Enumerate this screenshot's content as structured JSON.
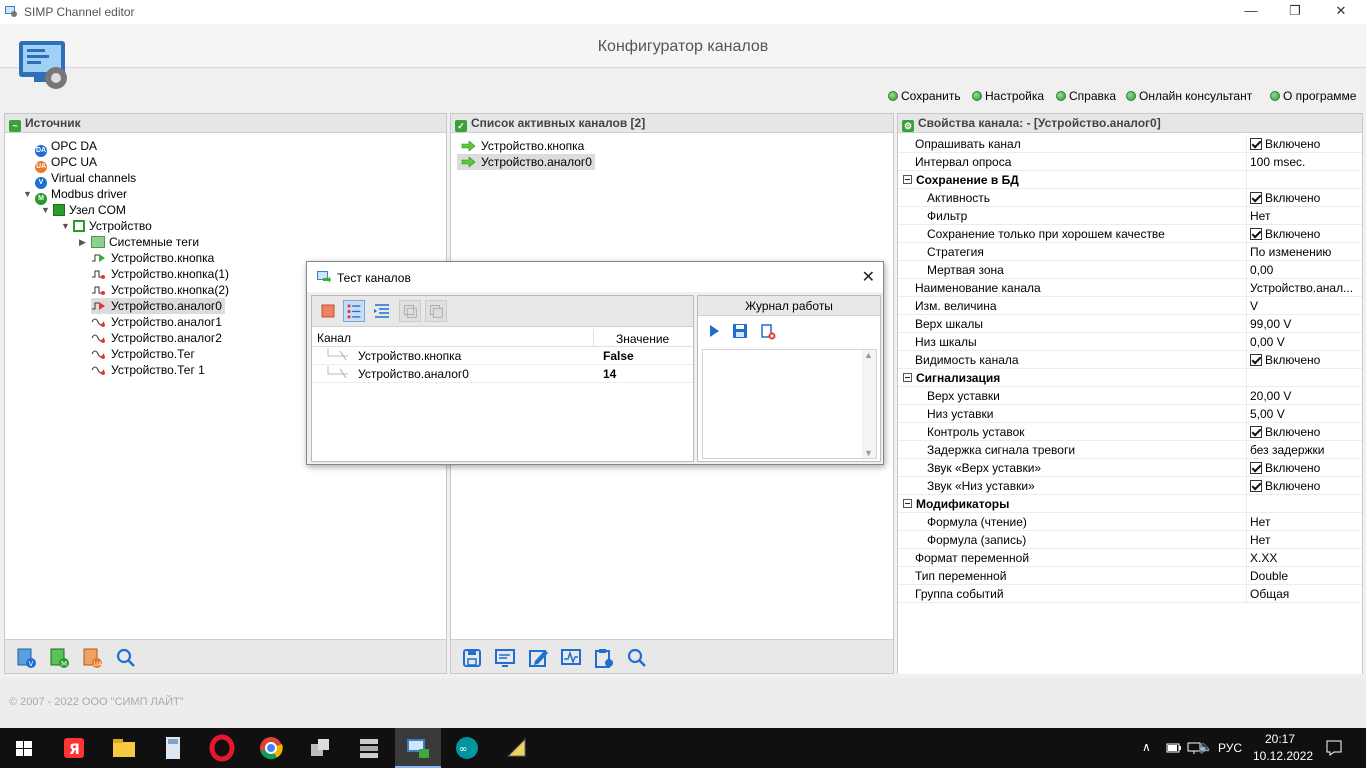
{
  "window": {
    "title": "SIMP Channel editor",
    "minimize": "—",
    "restore": "❐",
    "close": "✕"
  },
  "header": {
    "title": "Конфигуратор каналов"
  },
  "menu": [
    {
      "label": "Сохранить"
    },
    {
      "label": "Настройка"
    },
    {
      "label": "Справка"
    },
    {
      "label": "Онлайн консультант"
    },
    {
      "label": "О программе"
    }
  ],
  "source_panel": {
    "title": "Источник",
    "tree": [
      {
        "label": "OPC DA",
        "icon": "opc-da-icon"
      },
      {
        "label": "OPC UA",
        "icon": "opc-ua-icon"
      },
      {
        "label": "Virtual channels",
        "icon": "virtual-channels-icon"
      },
      {
        "label": "Modbus driver",
        "icon": "modbus-driver-icon"
      },
      {
        "label": "Узел COM",
        "icon": "com-node-icon"
      },
      {
        "label": "Устройство",
        "icon": "device-icon"
      },
      {
        "label": "Системные теги",
        "icon": "folder-icon"
      },
      {
        "label": "Устройство.кнопка",
        "icon": "channel-active-icon"
      },
      {
        "label": "Устройство.кнопка(1)",
        "icon": "channel-icon"
      },
      {
        "label": "Устройство.кнопка(2)",
        "icon": "channel-icon"
      },
      {
        "label": "Устройство.аналог0",
        "icon": "channel-active-icon"
      },
      {
        "label": "Устройство.аналог1",
        "icon": "channel-icon"
      },
      {
        "label": "Устройство.аналог2",
        "icon": "channel-icon"
      },
      {
        "label": "Устройство.Тег",
        "icon": "channel-icon"
      },
      {
        "label": "Устройство.Тег 1",
        "icon": "channel-icon"
      }
    ],
    "toolbar": [
      "add-virtual-icon",
      "add-modbus-icon",
      "add-opc-ua-icon",
      "search-icon"
    ]
  },
  "active_panel": {
    "title": "Список активных каналов [2]",
    "items": [
      {
        "label": "Устройство.кнопка"
      },
      {
        "label": "Устройство.аналог0"
      }
    ],
    "toolbar": [
      "save-icon",
      "monitor-icon",
      "edit-icon",
      "chart-icon",
      "settings-icon",
      "search-icon"
    ]
  },
  "props_panel": {
    "title": "Свойства канала: - [Устройство.аналог0]",
    "rows": [
      {
        "name": "Опрашивать канал",
        "value": "Включено",
        "check": true
      },
      {
        "name": "Интервал опроса",
        "value": "100 msec."
      },
      {
        "name": "Сохранение в БД",
        "value": "",
        "cat": true
      },
      {
        "name": "Активность",
        "value": "Включено",
        "check": true,
        "indent": true
      },
      {
        "name": "Фильтр",
        "value": "Нет",
        "indent": true
      },
      {
        "name": "Сохранение только при хорошем качестве",
        "value": "Включено",
        "check": true,
        "indent": true
      },
      {
        "name": "Стратегия",
        "value": "По изменению",
        "indent": true
      },
      {
        "name": "Мертвая зона",
        "value": "0,00",
        "indent": true
      },
      {
        "name": "Наименование канала",
        "value": "Устройство.анал..."
      },
      {
        "name": "Изм. величина",
        "value": "V"
      },
      {
        "name": "Верх шкалы",
        "value": "99,00 V"
      },
      {
        "name": "Низ шкалы",
        "value": "0,00 V"
      },
      {
        "name": "Видимость канала",
        "value": "Включено",
        "check": true
      },
      {
        "name": "Сигнализация",
        "value": "",
        "cat": true
      },
      {
        "name": "Верх уставки",
        "value": "20,00 V",
        "indent": true
      },
      {
        "name": "Низ уставки",
        "value": "5,00 V",
        "indent": true
      },
      {
        "name": "Контроль уставок",
        "value": "Включено",
        "check": true,
        "indent": true
      },
      {
        "name": "Задержка сигнала тревоги",
        "value": "без задержки",
        "indent": true
      },
      {
        "name": "Звук «Верх уставки»",
        "value": "Включено",
        "check": true,
        "indent": true
      },
      {
        "name": "Звук «Низ уставки»",
        "value": "Включено",
        "check": true,
        "indent": true
      },
      {
        "name": "Модификаторы",
        "value": "",
        "cat": true
      },
      {
        "name": "Формула (чтение)",
        "value": "Нет",
        "indent": true
      },
      {
        "name": "Формула (запись)",
        "value": "Нет",
        "indent": true
      },
      {
        "name": "Формат переменной",
        "value": "X.XX"
      },
      {
        "name": "Тип переменной",
        "value": "Double"
      },
      {
        "name": "Группа событий",
        "value": "Общая"
      }
    ]
  },
  "dialog": {
    "title": "Тест каналов",
    "col_channel": "Канал",
    "col_value": "Значение",
    "rows": [
      {
        "channel": "Устройство.кнопка",
        "value": "False"
      },
      {
        "channel": "Устройство.аналог0",
        "value": "14"
      }
    ],
    "log_title": "Журнал работы"
  },
  "footer": {
    "copyright": "© 2007 - 2022  ООО \"СИМП ЛАЙТ\""
  },
  "taskbar": {
    "apps": [
      "start-icon",
      "yandex-icon",
      "explorer-icon",
      "calculator-icon",
      "opera-icon",
      "chrome-icon",
      "app-icon",
      "server-icon",
      "simp-icon",
      "arduino-icon",
      "tool-icon"
    ],
    "lang": "РУС",
    "time": "20:17",
    "date": "10.12.2022"
  },
  "colors": {
    "accent_green": "#2a9a2a",
    "selection": "#dcdcdc",
    "taskbar": "#101010"
  }
}
